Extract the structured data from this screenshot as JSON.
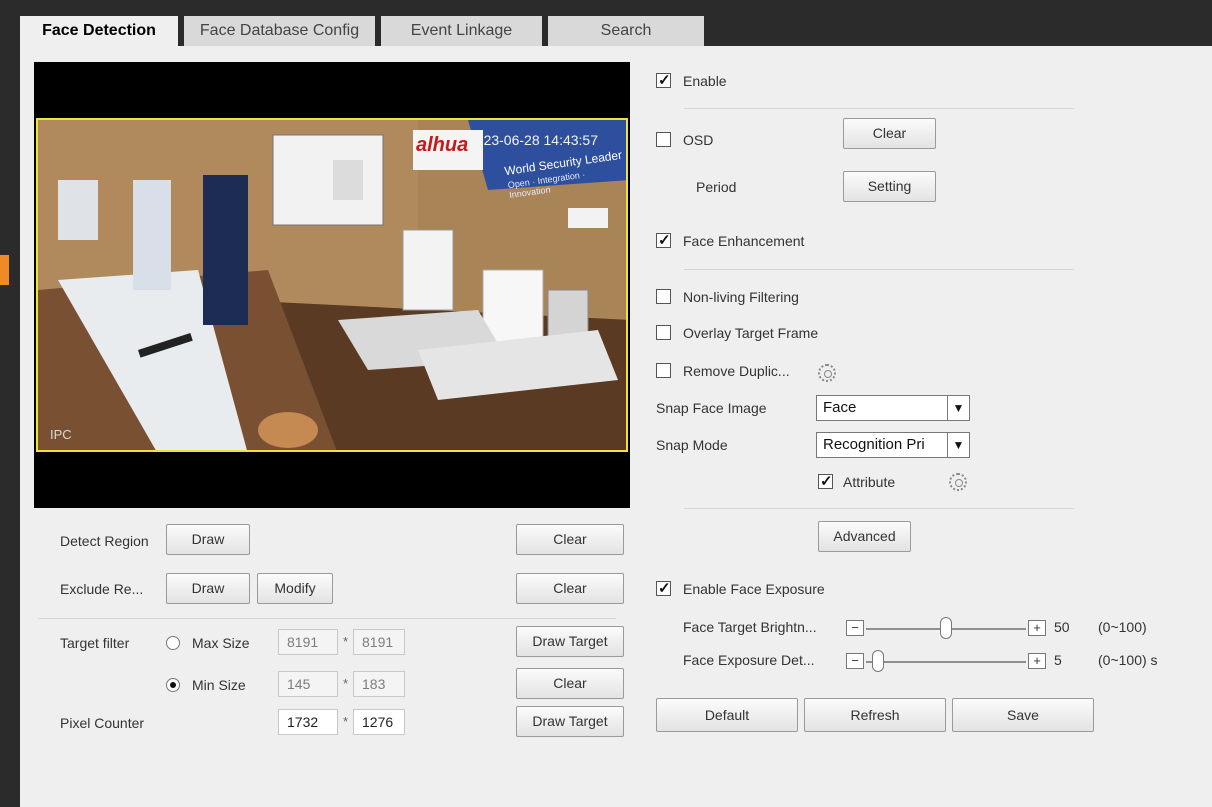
{
  "tabs": [
    {
      "label": "Face Detection",
      "active": true
    },
    {
      "label": "Face Database Config",
      "active": false
    },
    {
      "label": "Event Linkage",
      "active": false
    },
    {
      "label": "Search",
      "active": false
    }
  ],
  "video": {
    "corner_label": "IPC",
    "timestamp": "2023-06-28 14:43:57",
    "brand_text": "alhua",
    "banner_text": "World Security Leader",
    "banner_sub": "Open · Integration · Innovation"
  },
  "left": {
    "detect_region": {
      "label": "Detect Region",
      "draw": "Draw",
      "clear": "Clear"
    },
    "exclude_region": {
      "label": "Exclude Re...",
      "draw": "Draw",
      "modify": "Modify",
      "clear": "Clear"
    },
    "target_filter": {
      "label": "Target filter",
      "max": {
        "label": "Max Size",
        "w": "8191",
        "h": "8191",
        "selected": false
      },
      "min": {
        "label": "Min Size",
        "w": "145",
        "h": "183",
        "selected": true
      },
      "draw_target": "Draw Target",
      "clear": "Clear"
    },
    "pixel_counter": {
      "label": "Pixel Counter",
      "w": "1732",
      "h": "1276",
      "draw_target": "Draw Target"
    },
    "sep": "*"
  },
  "right": {
    "enable": {
      "label": "Enable",
      "checked": true
    },
    "osd": {
      "label": "OSD",
      "checked": false,
      "button": "Clear"
    },
    "period": {
      "label": "Period",
      "button": "Setting"
    },
    "face_enhancement": {
      "label": "Face Enhancement",
      "checked": true
    },
    "non_living": {
      "label": "Non-living Filtering",
      "checked": false
    },
    "overlay_target": {
      "label": "Overlay Target Frame",
      "checked": false
    },
    "remove_duplicate": {
      "label": "Remove Duplic...",
      "checked": false
    },
    "snap_face_image": {
      "label": "Snap Face Image",
      "value": "Face"
    },
    "snap_mode": {
      "label": "Snap Mode",
      "value": "Recognition Pri"
    },
    "attribute": {
      "label": "Attribute",
      "checked": true
    },
    "advanced": "Advanced",
    "enable_face_exposure": {
      "label": "Enable Face Exposure",
      "checked": true
    },
    "face_target_brightness": {
      "label": "Face Target Brightn...",
      "value": "50",
      "range": "(0~100)",
      "level": 50
    },
    "face_exposure_detect": {
      "label": "Face Exposure Det...",
      "value": "5",
      "range": "(0~100) s",
      "level": 5
    },
    "minus": "−",
    "plus": "+",
    "default": "Default",
    "refresh": "Refresh",
    "save": "Save"
  }
}
